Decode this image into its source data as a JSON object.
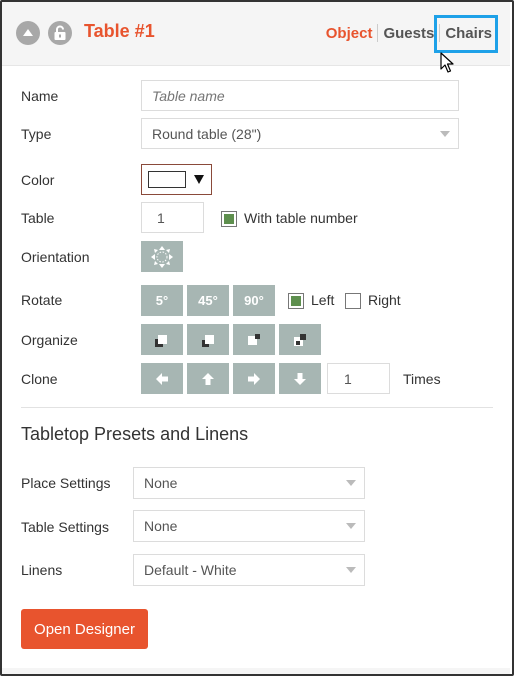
{
  "header": {
    "title": "Table #1",
    "tabs": [
      {
        "label": "Object",
        "active": true
      },
      {
        "label": "Guests",
        "active": false
      },
      {
        "label": "Chairs",
        "active": false,
        "highlighted": true
      }
    ],
    "accent_color": "#e8542e",
    "highlight_color": "#1ea1e8"
  },
  "form": {
    "name": {
      "label": "Name",
      "placeholder": "Table name",
      "value": ""
    },
    "type": {
      "label": "Type",
      "value": "Round table (28\")"
    },
    "color": {
      "label": "Color",
      "value": "#ffffff"
    },
    "table": {
      "label": "Table",
      "value": "1",
      "with_number_label": "With table number",
      "with_number_checked": true
    },
    "orientation": {
      "label": "Orientation",
      "icon": "move-arrows-icon"
    },
    "rotate": {
      "label": "Rotate",
      "buttons": [
        "5°",
        "45°",
        "90°"
      ],
      "left_label": "Left",
      "left_checked": true,
      "right_label": "Right",
      "right_checked": false
    },
    "organize": {
      "label": "Organize",
      "icons": [
        "bring-to-front-icon",
        "bring-forward-icon",
        "send-backward-icon",
        "send-to-back-icon"
      ]
    },
    "clone": {
      "label": "Clone",
      "icons": [
        "arrow-left-icon",
        "arrow-up-icon",
        "arrow-right-icon",
        "arrow-down-icon"
      ],
      "count": "1",
      "times_label": "Times"
    }
  },
  "presets": {
    "title": "Tabletop Presets and Linens",
    "place_settings": {
      "label": "Place Settings",
      "value": "None"
    },
    "table_settings": {
      "label": "Table Settings",
      "value": "None"
    },
    "linens": {
      "label": "Linens",
      "value": "Default - White"
    }
  },
  "actions": {
    "open_designer": "Open Designer"
  }
}
